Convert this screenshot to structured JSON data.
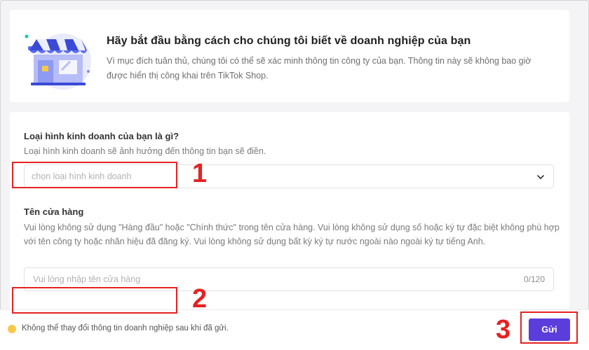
{
  "intro": {
    "title": "Hãy bắt đầu bằng cách cho chúng tôi biết về doanh nghiệp của bạn",
    "description": "Vì mục đích tuân thủ, chúng tôi có thể sẽ xác minh thông tin công ty của bạn. Thông tin này sẽ không bao giờ được hiển thị công khai trên TikTok Shop.",
    "illustration_icon": "shop-storefront-icon"
  },
  "business_type": {
    "label": "Loại hình kinh doanh của bạn là gì?",
    "hint": "Loại hình kinh doanh sẽ ảnh hưởng đến thông tin bạn sẽ điền.",
    "placeholder": "chọn loại hình kinh doanh",
    "dropdown_icon": "chevron-down-icon"
  },
  "shop_name": {
    "label": "Tên cửa hàng",
    "hint": "Vui lòng không sử dụng \"Hàng đầu\" hoặc \"Chính thức\" trong tên cửa hàng. Vui lòng không sử dụng số hoặc ký tự đặc biệt không phù hợp với tên công ty hoặc nhãn hiệu đã đăng ký. Vui lòng không sử dụng bất kỳ ký tự nước ngoài nào ngoài ký tự tiếng Anh.",
    "placeholder": "Vui lòng nhập tên cửa hàng",
    "value": "",
    "counter": "0/120"
  },
  "footer": {
    "note": "Không thể thay đổi thông tin doanh nghiệp sau khi đã gửi.",
    "submit_label": "Gửi",
    "warning_color": "#f7c948"
  },
  "annotations": {
    "n1": "1",
    "n2": "2",
    "n3": "3",
    "color": "#e42222"
  },
  "colors": {
    "primary": "#5b3ddb",
    "background": "#f4f4f6"
  }
}
